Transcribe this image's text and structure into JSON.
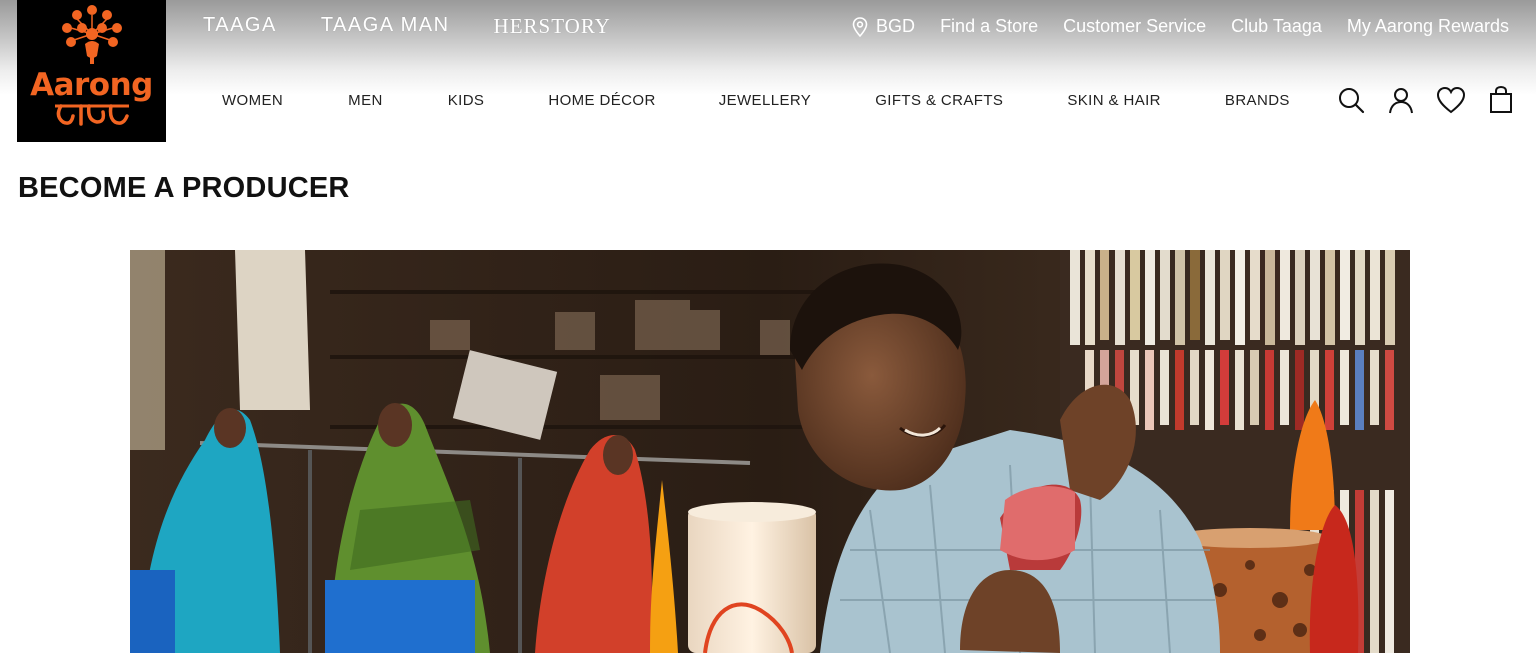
{
  "logo": {
    "text": "Aarong",
    "alt_text": "আড়ং"
  },
  "brand_links": [
    "TAAGA",
    "TAAGA MAN",
    "HERSTORY"
  ],
  "utility": {
    "location": "BGD",
    "find_store": "Find a Store",
    "customer_service": "Customer Service",
    "club": "Club Taaga",
    "rewards": "My Aarong Rewards"
  },
  "nav": [
    "WOMEN",
    "MEN",
    "KIDS",
    "HOME DÉCOR",
    "JEWELLERY",
    "GIFTS & CRAFTS",
    "SKIN & HAIR",
    "BRANDS"
  ],
  "icons": [
    "search-icon",
    "account-icon",
    "wishlist-heart-icon",
    "shopping-bag-icon",
    "location-pin-icon"
  ],
  "page_title": "BECOME A PRODUCER",
  "colors": {
    "brand_orange": "#f26522",
    "logo_bg": "#000000",
    "text": "#111111"
  }
}
